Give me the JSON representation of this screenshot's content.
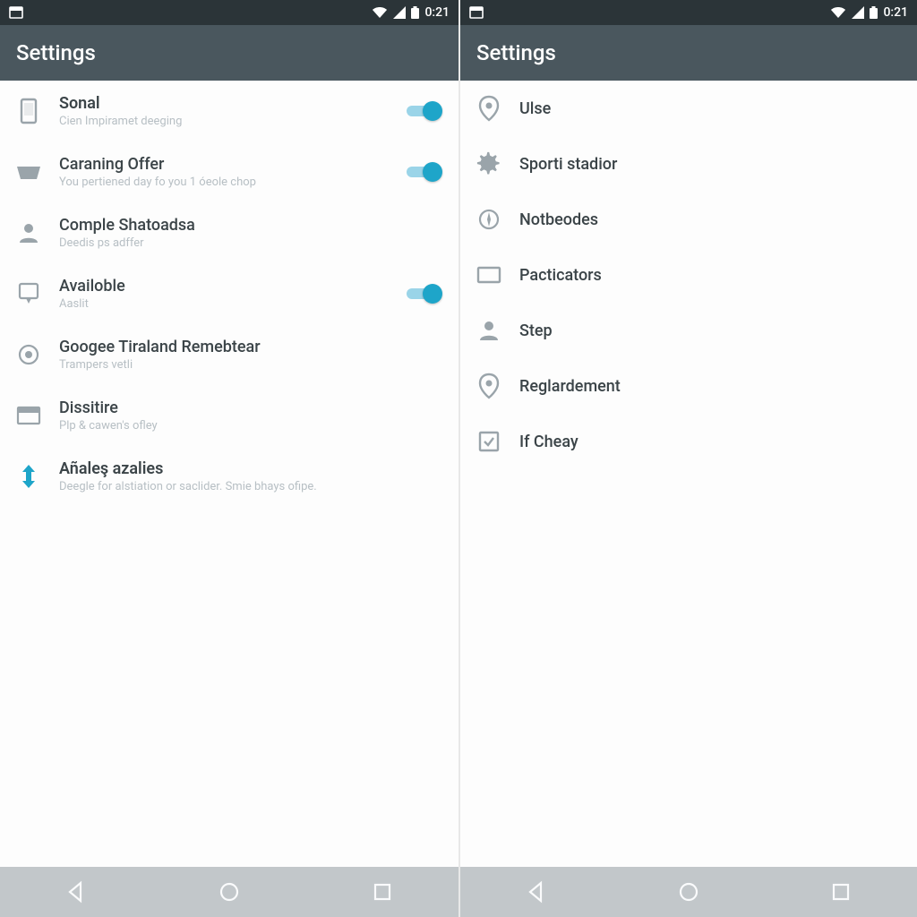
{
  "status": {
    "time": "0:21"
  },
  "colors": {
    "accent": "#1EA5C9",
    "appbar": "#4a575e",
    "statusbar": "#2b3438"
  },
  "left": {
    "title": "Settings",
    "items": [
      {
        "title": "Sonal",
        "sub": "Cien Impiramet deeging",
        "toggle": true
      },
      {
        "title": "Caraning Offer",
        "sub": "You pertiened day fo you 1 óeole chop",
        "toggle": true
      },
      {
        "title": "Comple Shatoadsa",
        "sub": "Deedis ps adffer",
        "toggle": false
      },
      {
        "title": "Availoble",
        "sub": "Aaslit",
        "toggle": true
      },
      {
        "title": "Googee Tiraland Remebtear",
        "sub": "Trampers vetli",
        "toggle": false
      },
      {
        "title": "Dissitire",
        "sub": "Plp & cawen's ofley",
        "toggle": false
      },
      {
        "title": "Añaleş azalies",
        "sub": "Deegle for alstiation or saclider. Smie bhays ofipe.",
        "toggle": false
      }
    ]
  },
  "right": {
    "title": "Settings",
    "items": [
      {
        "title": "Ulse"
      },
      {
        "title": "Sporti stadior"
      },
      {
        "title": "Notbeodes"
      },
      {
        "title": "Pacticators"
      },
      {
        "title": "Step"
      },
      {
        "title": "Reglardement"
      },
      {
        "title": "If Cheay"
      }
    ]
  }
}
